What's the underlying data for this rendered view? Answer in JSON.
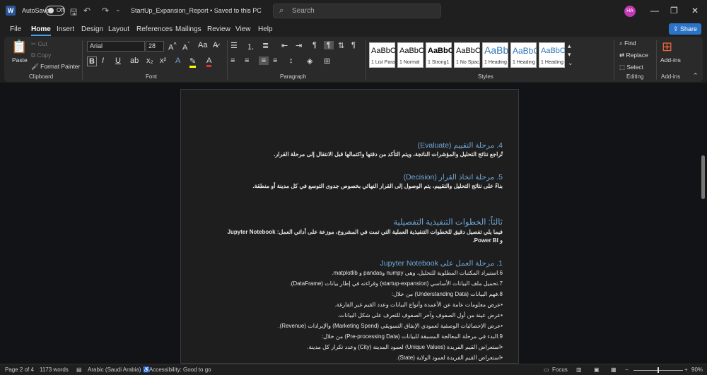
{
  "titlebar": {
    "autosave_label": "AutoSave",
    "autosave_state": "Off",
    "doc_title": "StartUp_Expansion_Report • Saved to this PC",
    "search_placeholder": "Search",
    "user_initials": "HA"
  },
  "menu": {
    "tabs": [
      "File",
      "Home",
      "Insert",
      "Design",
      "Layout",
      "References",
      "Mailings",
      "Review",
      "View",
      "Help"
    ],
    "active_tab": "Home",
    "share_label": "Share"
  },
  "ribbon": {
    "clipboard": {
      "paste": "Paste",
      "cut": "Cut",
      "copy": "Copy",
      "format_painter": "Format Painter",
      "label": "Clipboard"
    },
    "font": {
      "name": "Arial",
      "size": "28",
      "label": "Font",
      "bold": "B",
      "italic": "I",
      "underline": "U"
    },
    "paragraph": {
      "label": "Paragraph"
    },
    "styles": {
      "label": "Styles",
      "items": [
        {
          "sample": "AaBbCcl",
          "name": "1 List Para..."
        },
        {
          "sample": "AaBbCcl",
          "name": "1 Normal"
        },
        {
          "sample": "AaBbCc",
          "name": "1 Strong1"
        },
        {
          "sample": "AaBbCcl",
          "name": "1 No Spac..."
        },
        {
          "sample": "AaBb(",
          "name": "1 Heading 1"
        },
        {
          "sample": "AaBbC",
          "name": "1 Heading 2"
        },
        {
          "sample": "AaBbCc",
          "name": "1 Heading 3"
        }
      ]
    },
    "editing": {
      "find": "Find",
      "replace": "Replace",
      "select": "Select",
      "label": "Editing"
    },
    "addins": {
      "button": "Add-ins",
      "label": "Add-ins"
    }
  },
  "document": {
    "p1_head": "4. مرحلة التقييم (Evaluate)",
    "p1_body": "تُراجع نتائج التحليل والمؤشرات الناتجة، ويتم التأكد من دقتها واكتمالها قبل الانتقال إلى مرحلة القرار.",
    "p2_head": "5. مرحلة اتخاذ القرار (Decision)",
    "p2_body": "بناءً على نتائج التحليل والتقييم، يتم الوصول إلى القرار النهائي بخصوص جدوى التوسع في كل مدينة أو منطقة.",
    "p3_head": "ثالثاً: الخطوات التنفيذية التفصيلية",
    "p3_body1": "فيما يلي تفصيل دقيق للخطوات التنفيذية العملية التي تمت في المشروع، موزعة على أداتي العمل: Jupyter Notebook",
    "p3_body2": "و Power BI.",
    "p4_head": "1. مرحلة العمل على Jupyter Notebook",
    "items": [
      "6.استيراد المكتبات المطلوبة للتحليل، وهي numpy وpandas و matplotlib.",
      "7.تحميل ملف البيانات الأساسي (startup-expansion) وقراءته في إطار بيانات (DataFrame).",
      "8.فهم البيانات (Understanding Data) من خلال:",
      "•عرض معلومات عامة عن الأعمدة وأنواع البيانات وعدد القيم غير الفارغة.",
      "•عرض عينة من أول الصفوف وآخر الصفوف للتعرف على شكل البيانات.",
      "•عرض الإحصائيات الوصفية لعمودي الإنفاق التسويقي (Marketing Spend) والإيرادات (Revenue).",
      "9.البدء في مرحلة المعالجة المسبقة للبيانات (Pre-processing Data) من خلال:",
      "•استعراض القيم الفريدة (Unique Values) لعمود المدينة (City) وعدد تكرار كل مدينة.",
      "•استعراض القيم الفريدة لعمود الولاية (State)."
    ]
  },
  "status": {
    "page": "Page 2 of 4",
    "words": "1173 words",
    "language": "Arabic (Saudi Arabia)",
    "accessibility": "Accessibility: Good to go",
    "focus": "Focus",
    "zoom": "90%"
  }
}
